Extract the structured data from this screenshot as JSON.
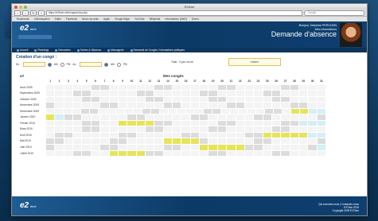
{
  "browser": {
    "title": "E2time",
    "url": "https://e2time.net/conges/view.php",
    "search_placeholder": "Google",
    "bookmarks": [
      "Bookmarks",
      "e2timesystem",
      "Editer",
      "Facebook",
      "Nous vos amis",
      "Apple",
      "Google Maps",
      "YouTube",
      "Wikipédia",
      "Informations (WeD)",
      "Divers"
    ]
  },
  "header": {
    "logo": "e2",
    "logo_sub": "time",
    "user_line1": "Bonjour,  Delphine PERCHON",
    "user_line2": "Mes informations",
    "page_title": "Demande d'absence"
  },
  "menu": [
    "Accueil",
    "Plannings",
    "Demandes",
    "Taches & Missions",
    "Messagerie",
    "Demande de Congés / Informations pratiques"
  ],
  "form": {
    "heading": "Création d'un congé :",
    "du_label": "Du :",
    "au_label": "Au :",
    "am": "AM",
    "pm": "PM",
    "total": "Total : 0 jour ouvré",
    "valider": "Valider"
  },
  "calendar": {
    "brand": "e2",
    "title": "Mes congés",
    "days": [
      "1",
      "2",
      "3",
      "4",
      "5",
      "6",
      "7",
      "8",
      "9",
      "10",
      "11",
      "12",
      "13",
      "14",
      "15",
      "16",
      "17",
      "18",
      "19",
      "20",
      "21",
      "22",
      "23",
      "24",
      "25",
      "26",
      "27",
      "28",
      "29",
      "30",
      "31"
    ],
    "months": [
      {
        "label": "Août 2009",
        "cells": "xxxxxwwxxxxxwwxxxxxwwxxxxxwwxxx"
      },
      {
        "label": "Septembre 2009",
        "cells": "xxxwwxxxxxwwxxxxxwwxxxxxwwxxxxx"
      },
      {
        "label": "Octobre 2009",
        "cells": "xxxxwwxxxxxwwxxxxxwwxxxxxwwxxxx"
      },
      {
        "label": "Novembre 2009",
        "cells": "wxxxxxwwxxxxxwwxxxxxwwxxxxxwwxx"
      },
      {
        "label": "Décembre 2009",
        "cells": "xxxxwwxxxxxwwxxxxxwwxxxxxwwxccee"
      },
      {
        "label": "Janvier 2010",
        "cells": "cewwxxxxxwwxxxxxwwxxxxxwwxxxxxw"
      },
      {
        "label": "Février 2010",
        "cells": "xxxxwwxxccccwwxxxxxwwxxxxxwweee"
      },
      {
        "label": "Mars 2010",
        "cells": "xxxxwwxxxxxwwxxxxxwwxxxxxwwxxxx"
      },
      {
        "label": "Avril 2010",
        "cells": "xwwxxxxxwwxxxxxwwxxxxxwwcccccee"
      },
      {
        "label": "Mai 2010",
        "cells": "wwxxxxxwwxxxxccccwxxxxxwwxxxxxw"
      },
      {
        "label": "Juin 2010",
        "cells": "wxxxxxwwxxxxxwwxxcccccwwxxxxxwe"
      },
      {
        "label": "Juillet 2010",
        "cells": "xxxwwxxccccwwxxxxxwwxxxxxwwxxxx"
      }
    ],
    "legend_label": "Afficher les vacances :",
    "legend_options": [
      "Aucune",
      "Zone A",
      "Zone B",
      "Zone C"
    ]
  },
  "footer": {
    "logo": "e2",
    "logo_sub": "time",
    "line1": "Qui sommes-nous  |  Contactez-nous",
    "line2": "E2Time 2010",
    "line3": "Copyright 2009 E2Time"
  }
}
